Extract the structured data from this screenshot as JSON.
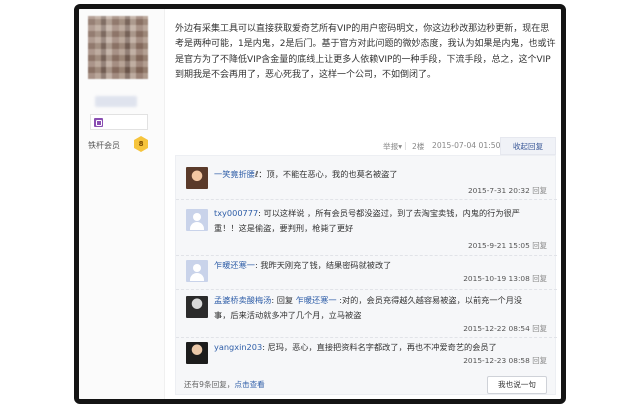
{
  "member": {
    "label": "铁杆会员",
    "level": "8"
  },
  "post": {
    "text": "外边有采集工具可以直接获取爱奇艺所有VIP的用户密码明文，你这边秒改那边秒更新，现在思考是两种可能，1是内鬼，2是后门。基于官方对此问题的微妙态度，我认为如果是内鬼，也或许是官方为了不降低VIP含金量的底线上让更多人依赖VIP的一种手段，下流手段，总之，这个VIP到期我是不会再用了，恶心死我了，这样一个公司，不如倒闭了。",
    "report": "举报",
    "report_caret": "▾",
    "floor": "2楼",
    "time": "2015-07-04 01:50",
    "collapse_label": "收起回复"
  },
  "replies": [
    {
      "user": "一笑竟折腰",
      "text": "ℓ：顶，不能在恶心，我的也莫名被盗了",
      "time": "2015-7-31 20:32",
      "reply_label": "回复"
    },
    {
      "user": "txy000777",
      "text": ": 可以这样说 ，所有会员号都没盗过，到了去淘宝卖钱，内鬼的行为很严重！！这是偷盗，要判刑，枪毙了更好",
      "time": "2015-9-21 15:05",
      "reply_label": "回复"
    },
    {
      "user": "乍暖还寒一",
      "text": ": 我昨天刚充了钱，结果密码就被改了",
      "time": "2015-10-19 13:08",
      "reply_label": "回复"
    },
    {
      "user": "孟婆桥卖酸梅汤",
      "text_prefix": ": 回复 ",
      "text_target": "乍暖还寒一",
      "text": " :对的，会员充得越久越容易被盗，以前充一个月没事，后来活动就多冲了几个月，立马被盗",
      "time": "2015-12-22 08:54",
      "reply_label": "回复"
    },
    {
      "user": "yangxin203",
      "text": ": 尼玛，恶心，直接把资料名字都改了，再也不冲爱奇艺的会员了",
      "time": "2015-12-23 08:58",
      "reply_label": "回复"
    }
  ],
  "footer": {
    "more_prefix": "还有9条回复，",
    "more_link": "点击查看",
    "say_button": "我也说一句"
  },
  "icons": [
    "avatar-blurred",
    "member-badge-icon",
    "level-badge-icon",
    "reply-avatar"
  ]
}
